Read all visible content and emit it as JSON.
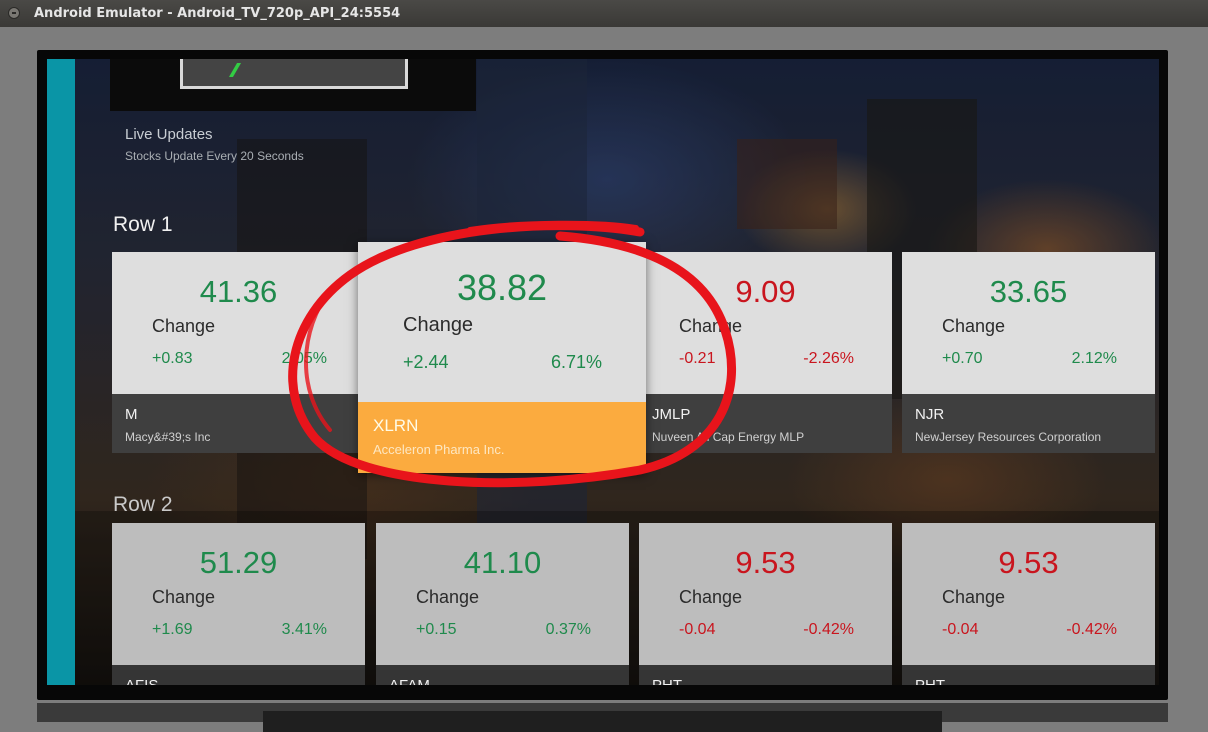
{
  "window": {
    "title": "Android Emulator - Android_TV_720p_API_24:5554"
  },
  "header": {
    "title": "Live Updates",
    "subtitle": "Stocks Update Every 20 Seconds"
  },
  "rows": [
    {
      "title": "Row 1",
      "cards": [
        {
          "price": "41.36",
          "change_label": "Change",
          "delta": "+0.83",
          "percent": "2.05%",
          "symbol": "M",
          "company": "Macy&#39;s Inc",
          "trend": "up"
        },
        {
          "price": "38.82",
          "change_label": "Change",
          "delta": "+2.44",
          "percent": "6.71%",
          "symbol": "XLRN",
          "company": "Acceleron Pharma Inc.",
          "trend": "up",
          "focused": true
        },
        {
          "price": "9.09",
          "change_label": "Change",
          "delta": "-0.21",
          "percent": "-2.26%",
          "symbol": "JMLP",
          "company": "Nuveen All Cap Energy MLP",
          "trend": "down"
        },
        {
          "price": "33.65",
          "change_label": "Change",
          "delta": "+0.70",
          "percent": "2.12%",
          "symbol": "NJR",
          "company": "NewJersey Resources Corporation",
          "trend": "up"
        }
      ]
    },
    {
      "title": "Row 2",
      "cards": [
        {
          "price": "51.29",
          "change_label": "Change",
          "delta": "+1.69",
          "percent": "3.41%",
          "symbol": "AFIS",
          "trend": "up"
        },
        {
          "price": "41.10",
          "change_label": "Change",
          "delta": "+0.15",
          "percent": "0.37%",
          "symbol": "AFAM",
          "trend": "up"
        },
        {
          "price": "9.53",
          "change_label": "Change",
          "delta": "-0.04",
          "percent": "-0.42%",
          "symbol": "PHT",
          "trend": "down"
        },
        {
          "price": "9.53",
          "change_label": "Change",
          "delta": "-0.04",
          "percent": "-0.42%",
          "symbol": "PHT",
          "trend": "down"
        }
      ]
    }
  ],
  "colors": {
    "up": "#1f8a4c",
    "down": "#c9151e",
    "accent": "#0a95a6",
    "focus": "#fbab3f",
    "annotation": "#e8141b"
  },
  "annotation": {
    "shape": "freehand ellipse",
    "target": "focused card"
  }
}
